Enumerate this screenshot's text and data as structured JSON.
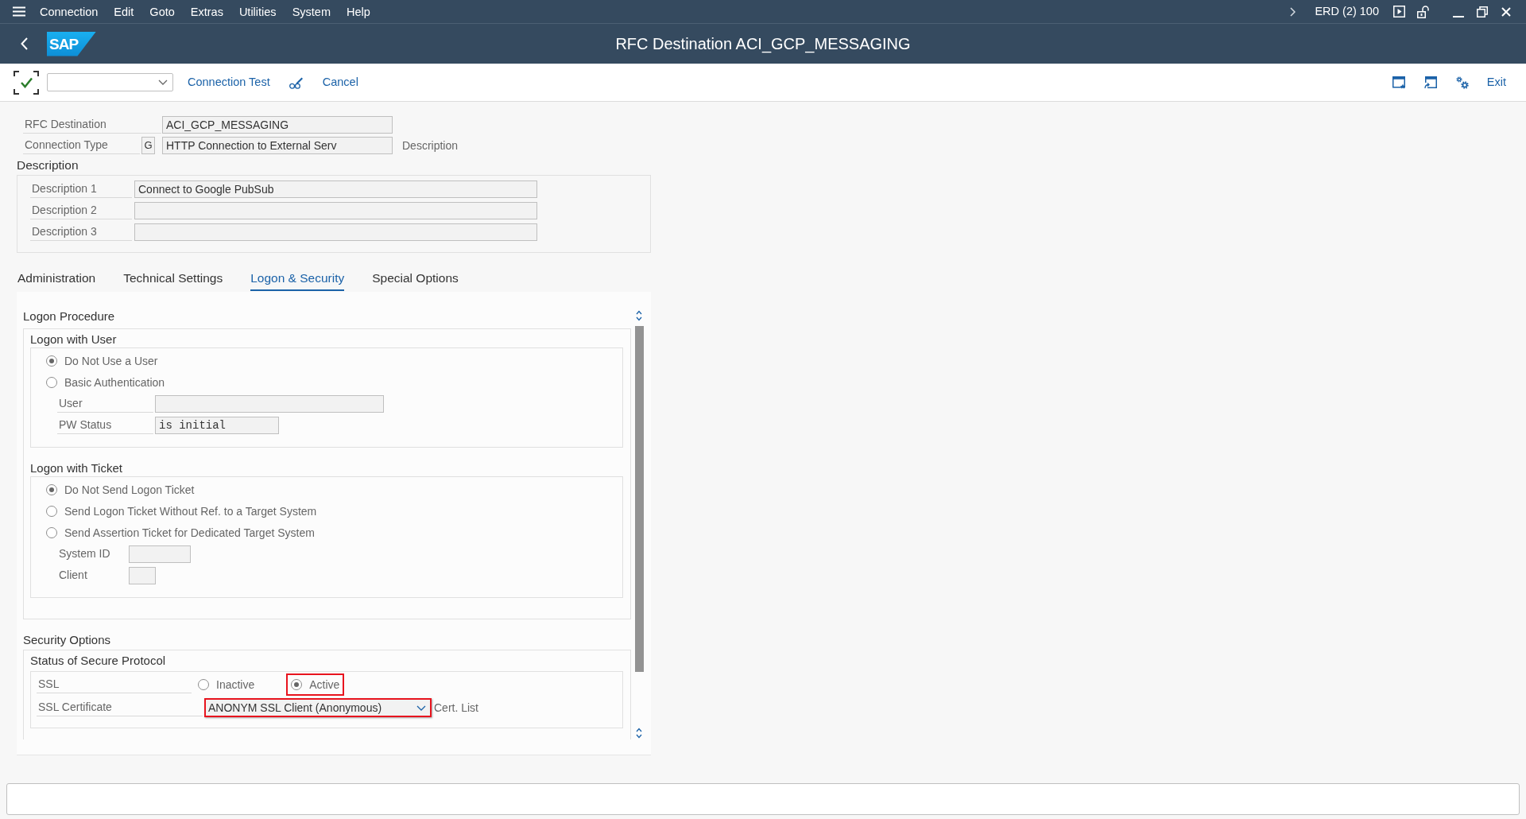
{
  "menu_bar": {
    "items": [
      "Connection",
      "Edit",
      "Goto",
      "Extras",
      "Utilities",
      "System",
      "Help"
    ],
    "session": "ERD (2) 100"
  },
  "title_bar": {
    "logo": "SAP",
    "title": "RFC Destination ACI_GCP_MESSAGING"
  },
  "toolbar": {
    "buttons": [
      "Connection Test",
      "Cancel"
    ],
    "exit": "Exit"
  },
  "header": {
    "destination": {
      "label": "RFC Destination",
      "value": "ACI_GCP_MESSAGING"
    },
    "connection_type": {
      "label": "Connection Type",
      "code": "G",
      "value": "HTTP Connection to External Serv",
      "caption": "Description"
    }
  },
  "description": {
    "title": "Description",
    "fields": [
      {
        "label": "Description 1",
        "value": "Connect to Google PubSub"
      },
      {
        "label": "Description 2"
      },
      {
        "label": "Description 3"
      }
    ]
  },
  "tabs": [
    {
      "label": "Administration",
      "selected": false
    },
    {
      "label": "Technical Settings",
      "selected": false
    },
    {
      "label": "Logon & Security",
      "selected": true
    },
    {
      "label": "Special Options",
      "selected": false
    }
  ],
  "logon_procedure": {
    "title": "Logon Procedure",
    "groups": [
      {
        "title": "Logon with User",
        "rows": [
          {
            "kind": "radio",
            "label": "Do Not Use a User",
            "selected": true
          },
          {
            "kind": "radio",
            "label": "Basic Authentication",
            "selected": false
          },
          {
            "kind": "field",
            "label": "User"
          },
          {
            "kind": "status",
            "label": "PW Status",
            "value": "is initial"
          }
        ]
      },
      {
        "title": "Logon with Ticket",
        "rows": [
          {
            "kind": "radio",
            "label": "Do Not Send Logon Ticket",
            "selected": true
          },
          {
            "kind": "radio",
            "label": "Send Logon Ticket Without Ref. to a Target System",
            "selected": false
          },
          {
            "kind": "radio",
            "label": "Send Assertion Ticket for Dedicated Target System",
            "selected": false
          },
          {
            "kind": "field",
            "label": "System ID"
          },
          {
            "kind": "field",
            "label": "Client"
          }
        ]
      }
    ]
  },
  "security_options": {
    "title": "Security Options",
    "group": {
      "title": "Status of Secure Protocol",
      "ssl": {
        "label": "SSL",
        "options": [
          {
            "label": "Inactive",
            "selected": false
          },
          {
            "label": "Active",
            "selected": true,
            "color": "#e8141e"
          }
        ]
      },
      "certificate": {
        "label": "SSL Certificate",
        "value": "ANONYM SSL Client (Anonymous)",
        "outlined": true,
        "action": "Cert. List"
      }
    }
  }
}
